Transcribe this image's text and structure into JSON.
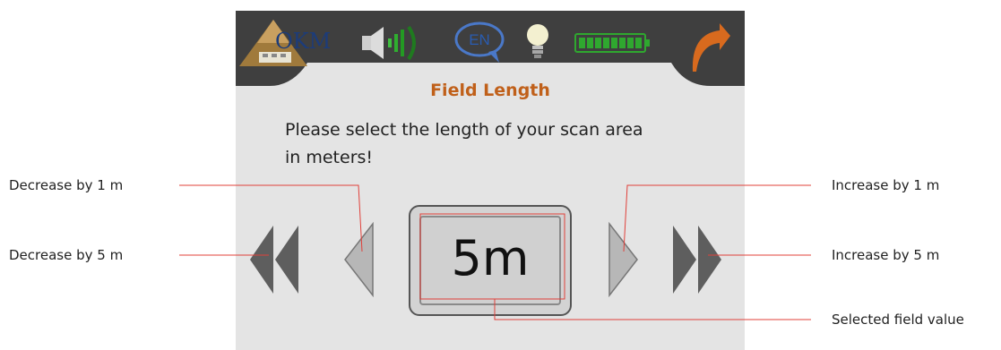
{
  "device": {
    "logo_text": "OKM",
    "language": "EN",
    "title": "Field Length",
    "instruction_line1": "Please select the length of your scan area",
    "instruction_line2": "in meters!",
    "field_value": "5m",
    "battery_level": 1.0
  },
  "icons": {
    "logo": "okm-pyramid-logo",
    "speaker": "speaker-volume-icon",
    "language": "language-bubble-icon",
    "light": "light-bulb-icon",
    "battery": "battery-icon",
    "back": "back-arrow-icon"
  },
  "annotations": {
    "decrease_1": "Decrease by 1 m",
    "decrease_5": "Decrease by 5 m",
    "increase_1": "Increase by 1 m",
    "increase_5": "Increase by 5 m",
    "selected": "Selected field value"
  },
  "colors": {
    "title": "#c0601a",
    "annotation_line": "#e0403a",
    "screen_bg": "#e4e4e4",
    "topbar": "#3f3f3f",
    "battery": "#2fa82f",
    "back_arrow": "#d86a1e"
  }
}
